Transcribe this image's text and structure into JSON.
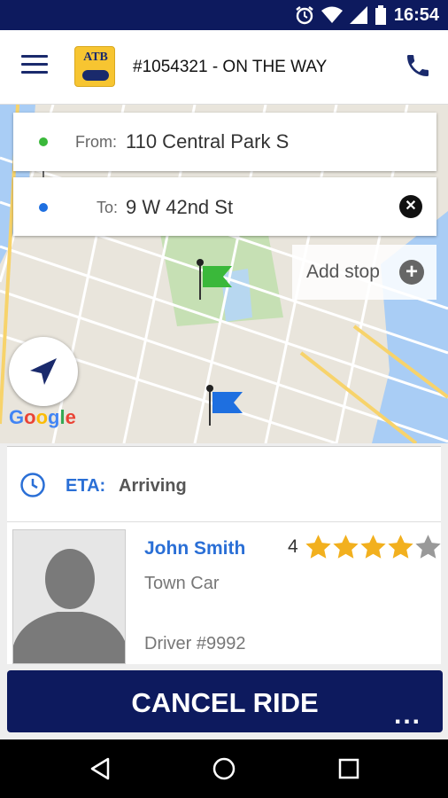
{
  "status_bar": {
    "time": "16:54",
    "icons": [
      "alarm-icon",
      "wifi-icon",
      "signal-icon",
      "battery-icon"
    ]
  },
  "header": {
    "ride_title": "#1054321 - ON THE WAY",
    "logo_text": "ATB"
  },
  "route": {
    "from_label": "From:",
    "from_value": "110 Central Park S",
    "to_label": "To:",
    "to_value": "9 W 42nd St",
    "add_stop": "Add stop"
  },
  "map": {
    "attribution": "Google"
  },
  "eta": {
    "label": "ETA:",
    "value": "Arriving"
  },
  "driver": {
    "name": "John Smith",
    "car": "Town Car",
    "number": "Driver #9992",
    "rating": 4,
    "rating_max": 5
  },
  "actions": {
    "cancel": "CANCEL RIDE",
    "more": "..."
  },
  "colors": {
    "brand_dark": "#0d1a5e",
    "accent_blue": "#2a6fd6",
    "star": "#f2b01e",
    "pickup": "#39a935",
    "dropoff": "#1e6fe0"
  }
}
